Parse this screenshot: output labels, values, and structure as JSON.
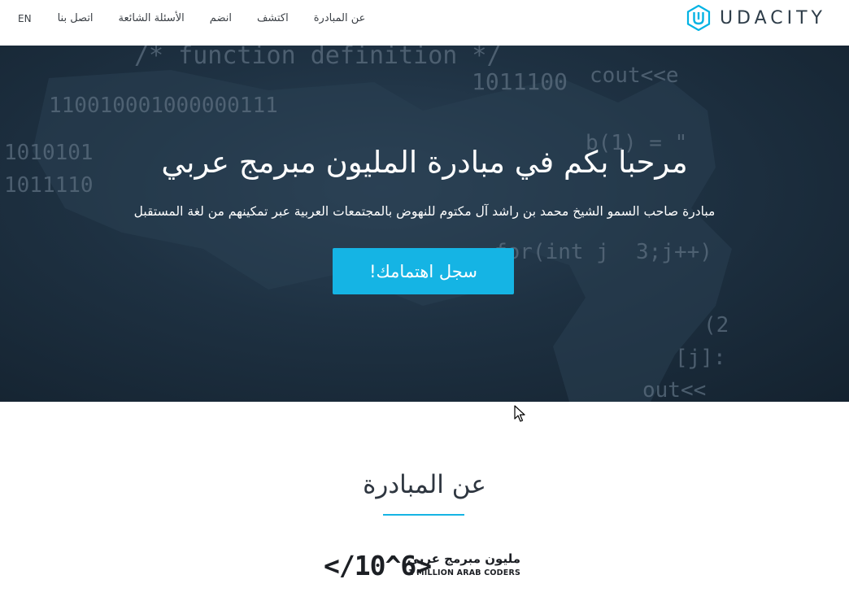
{
  "header": {
    "logo_text": "UDACITY",
    "nav": {
      "en": "EN",
      "contact": "اتصل بنا",
      "faq": "الأسئلة الشائعة",
      "join": "انضم",
      "explore": "اكتشف",
      "about": "عن المبادرة"
    }
  },
  "hero": {
    "title": "مرحبا بكم في مبادرة المليون مبرمج عربي",
    "subtitle": "مبادرة صاحب السمو الشيخ محمد بن راشد آل مكتوم للنهوض بالمجتمعات العربية عبر تمكينهم من لغة المستقبل",
    "cta_label": "سجل اهتمامك!",
    "background_code": {
      "line1": "/* function definition */",
      "line2": "1011100",
      "line3": "cout<<e",
      "line4": "110010001000000111",
      "line5": "1010101",
      "line6": "1011110",
      "line7": "b(1) = \"",
      "line8": "for(int j",
      "line9": "3;j++)",
      "line10": "(2",
      "line11": "[j]:",
      "line12": "out<<"
    }
  },
  "about": {
    "title": "عن المبادرة",
    "brand_code": "</10^6>",
    "brand_ar": "مليون مبرمج عربي",
    "brand_en": "1 MILLION ARAB CODERS"
  },
  "colors": {
    "accent": "#15b4e4",
    "hero_dark": "#1e3142",
    "logo": "#2e3d49"
  }
}
